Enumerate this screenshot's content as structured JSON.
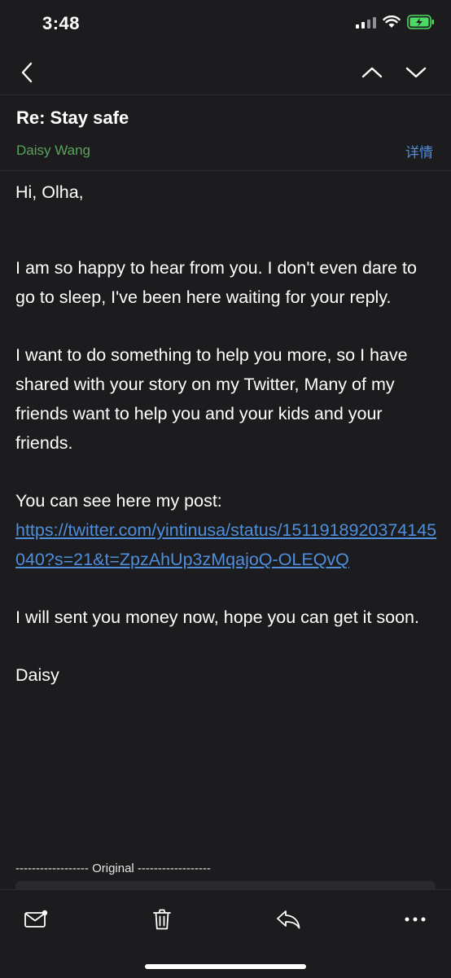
{
  "status_bar": {
    "time": "3:48"
  },
  "nav": {
    "back_icon": "chevron-left-icon",
    "prev_icon": "chevron-up-icon",
    "next_icon": "chevron-down-icon"
  },
  "email": {
    "subject": "Re: Stay safe",
    "sender": "Daisy Wang",
    "details_label": "详情",
    "greeting": "Hi, Olha,",
    "paragraph1": "I am so happy to hear from you. I don't even dare to go to sleep, I've been here waiting for your reply.",
    "paragraph2": "I want to do something to help you more, so I have shared with your story on my Twitter, Many of my friends want to help you and your kids and your friends.",
    "paragraph3": "You can see here my post:",
    "link": "https://twitter.com/yintinusa/status/1511918920374145040?s=21&t=ZpzAhUp3zMqajoQ-OLEQvQ",
    "paragraph4": "I will sent you money now, hope you can get it soon.",
    "signature": "Daisy",
    "original_separator": "------------------ Original ------------------"
  },
  "toolbar": {
    "compose_icon": "mail-icon",
    "delete_icon": "trash-icon",
    "reply_icon": "reply-icon",
    "more_icon": "more-icon"
  },
  "colors": {
    "background": "#1c1c1e",
    "sender": "#59a45b",
    "link": "#4f8edb",
    "battery": "#4cd964"
  }
}
